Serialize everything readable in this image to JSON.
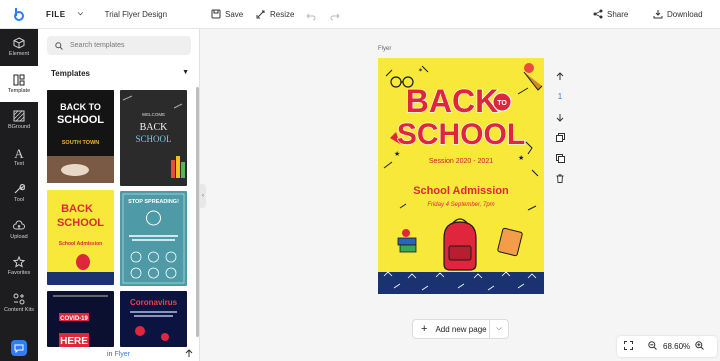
{
  "topbar": {
    "file_label": "FILE",
    "doc_title": "Trial Flyer Design",
    "save_label": "Save",
    "resize_label": "Resize",
    "share_label": "Share",
    "download_label": "Download"
  },
  "rail": {
    "items": [
      {
        "label": "Element",
        "icon": "cube-icon"
      },
      {
        "label": "Template",
        "icon": "layout-icon"
      },
      {
        "label": "BGround",
        "icon": "background-icon"
      },
      {
        "label": "Text",
        "icon": "text-icon"
      },
      {
        "label": "Tool",
        "icon": "wrench-icon"
      },
      {
        "label": "Upload",
        "icon": "cloud-upload-icon"
      },
      {
        "label": "Favorites",
        "icon": "star-icon"
      },
      {
        "label": "Content Kits",
        "icon": "kits-icon"
      }
    ]
  },
  "panel": {
    "search_placeholder": "Search templates",
    "section_title": "Templates",
    "footer_in": "in",
    "footer_link": "Flyer",
    "thumbs": {
      "t1": {
        "line1": "BACK TO",
        "line2": "SCHOOL",
        "line3": "SOUTH TOWN"
      },
      "t2": {
        "line1": "WELCOME",
        "line2": "BACK",
        "line3": "SCHOOL"
      },
      "t3": {
        "line1": "BACK",
        "line2": "SCHOOL",
        "line3": "School Admission"
      },
      "t4": {
        "line1": "STOP SPREADING!"
      },
      "t5": {
        "line1": "COVID-19",
        "line2": "HERE"
      },
      "t6": {
        "line1": "Coronavirus"
      }
    }
  },
  "canvas": {
    "label": "Flyer",
    "page_number": "1",
    "flyer": {
      "title_top": "BACK",
      "to_badge": "TO",
      "title_bottom": "SCHOOL",
      "session": "Session 2020 - 2021",
      "admission": "School Admission",
      "date_line": "Friday 4 September, 7pm"
    },
    "add_page_label": "Add new page",
    "zoom": "68.60%"
  },
  "colors": {
    "accent": "#2f7cf6",
    "flyer_yellow": "#f7e83a",
    "flyer_red": "#e0263c",
    "flyer_navy": "#1a3370"
  }
}
